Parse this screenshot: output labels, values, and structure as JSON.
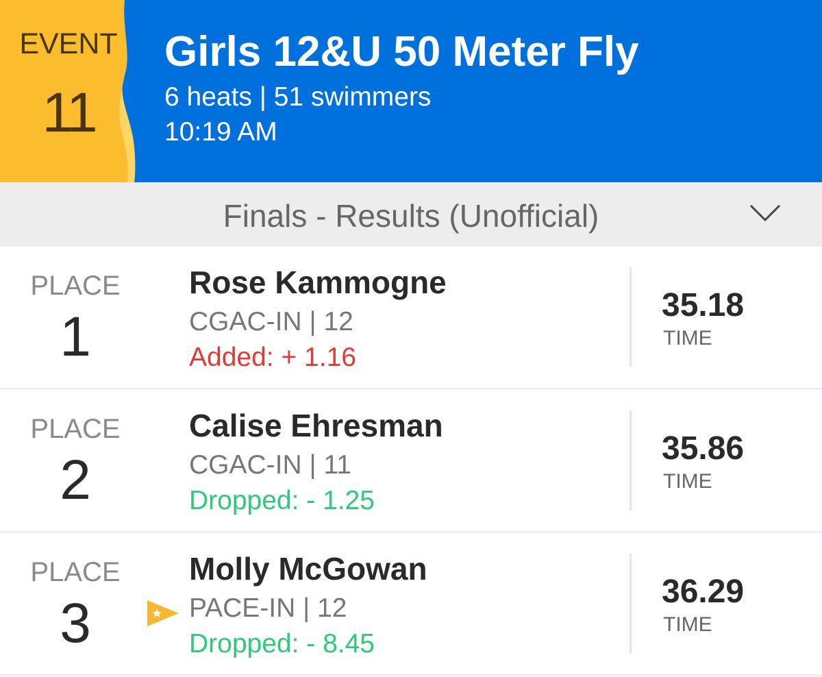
{
  "header": {
    "event_label": "EVENT",
    "event_number": "11",
    "title": "Girls 12&U 50 Meter Fly",
    "meta": "6 heats | 51 swimmers",
    "time": "10:19 AM",
    "colors": {
      "background": "#0070dc",
      "badge": "#fbbd2e",
      "badge_text": "#4a3510"
    }
  },
  "section": {
    "title": "Finals - Results (Unofficial)",
    "toggle_icon": "chevron-down-icon"
  },
  "results": [
    {
      "place_label": "PLACE",
      "place": "1",
      "name": "Rose Kammogne",
      "team": "CGAC-IN | 12",
      "change": "Added: + 1.16",
      "change_type": "added",
      "time": "35.18",
      "time_label": "TIME",
      "star": false
    },
    {
      "place_label": "PLACE",
      "place": "2",
      "name": "Calise Ehresman",
      "team": "CGAC-IN | 11",
      "change": "Dropped: - 1.25",
      "change_type": "dropped",
      "time": "35.86",
      "time_label": "TIME",
      "star": false
    },
    {
      "place_label": "PLACE",
      "place": "3",
      "name": "Molly McGowan",
      "team": "PACE-IN | 12",
      "change": "Dropped: - 8.45",
      "change_type": "dropped",
      "time": "36.29",
      "time_label": "TIME",
      "star": true,
      "star_icon": "star-flag-icon"
    }
  ],
  "colors": {
    "added": "#e23b36",
    "dropped": "#2fc97a"
  }
}
